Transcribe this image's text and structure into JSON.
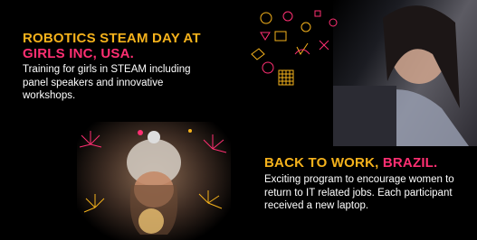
{
  "left_card": {
    "title_part1": "ROBOTICS STEAM DAY AT",
    "title_part2": "GIRLS INC, USA.",
    "body": "Training for girls in STEAM including panel speakers and innovative workshops."
  },
  "right_card": {
    "title_part1": "BACK TO WORK, ",
    "title_part2": "BRAZIL.",
    "body": "Exciting program to encourage women to return to IT related jobs. Each participant received a new laptop."
  },
  "colors": {
    "accent_yellow": "#f5b21c",
    "accent_pink": "#ff2f72",
    "text_white": "#ffffff",
    "background": "#000000"
  },
  "icons": [
    "fireworks-icon",
    "sparkler-icon",
    "tech-doodle-icon"
  ]
}
